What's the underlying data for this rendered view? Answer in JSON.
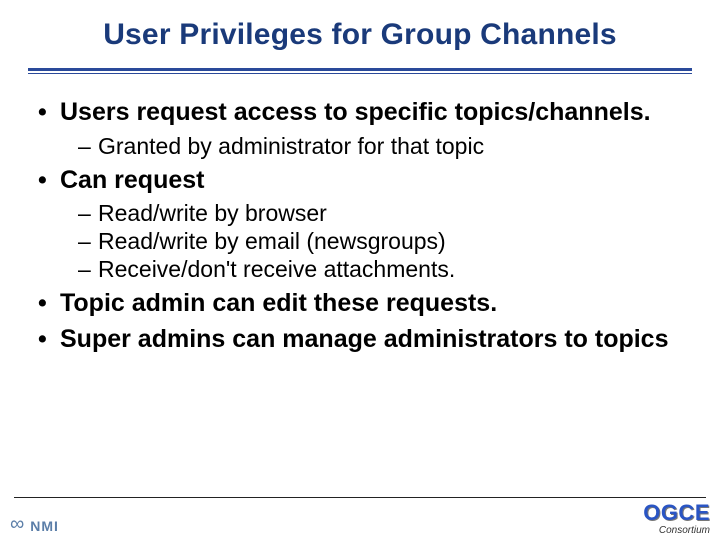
{
  "title": "User Privileges for Group Channels",
  "bullets": [
    {
      "text": "Users request access to specific topics/channels.",
      "sub": [
        "Granted by administrator for that topic"
      ]
    },
    {
      "text": "Can request",
      "sub": [
        "Read/write by browser",
        "Read/write by email (newsgroups)",
        "Receive/don't receive attachments."
      ]
    },
    {
      "text": "Topic admin can edit these requests.",
      "sub": []
    },
    {
      "text": "Super admins can manage administrators to topics",
      "sub": []
    }
  ],
  "footer": {
    "nmi": "NMI",
    "ogce": "OGCE",
    "consortium": "Consortium"
  }
}
